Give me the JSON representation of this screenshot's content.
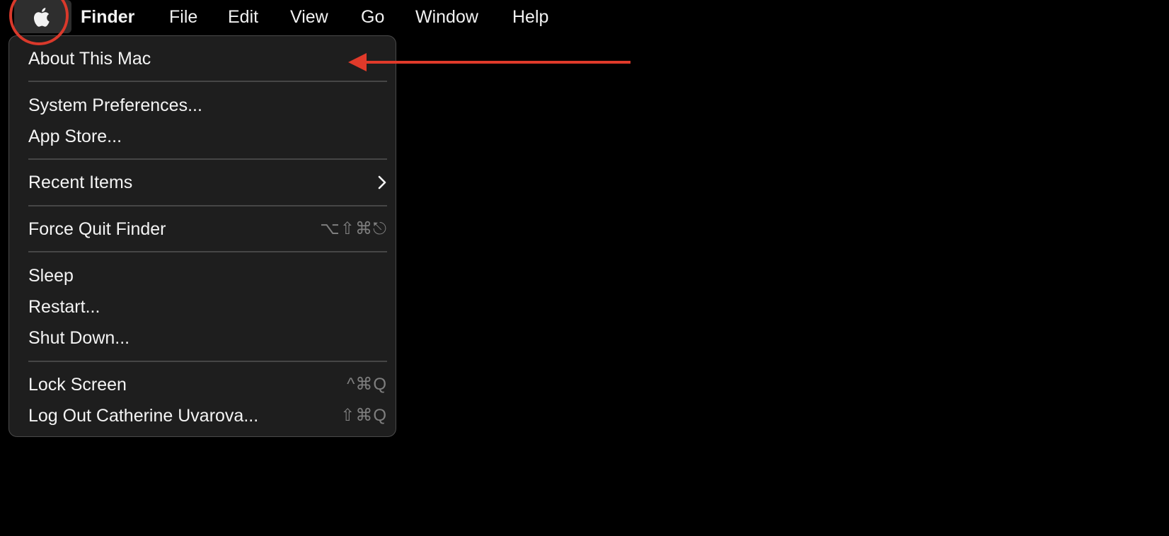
{
  "menubar": {
    "app_name": "Finder",
    "items": [
      "File",
      "Edit",
      "View",
      "Go",
      "Window",
      "Help"
    ],
    "apple_icon": "apple-logo-icon"
  },
  "apple_menu": {
    "about": "About This Mac",
    "system_preferences": "System Preferences...",
    "app_store": "App Store...",
    "recent_items": "Recent Items",
    "force_quit": "Force Quit Finder",
    "force_quit_shortcut": "⌥⇧⌘⎋",
    "sleep": "Sleep",
    "restart": "Restart...",
    "shut_down": "Shut Down...",
    "lock_screen": "Lock Screen",
    "lock_screen_shortcut": "^⌘Q",
    "log_out": "Log Out Catherine Uvarova...",
    "log_out_shortcut": "⇧⌘Q"
  },
  "annotations": {
    "highlight_color": "#d9392b",
    "arrow_color": "#e03a2a"
  },
  "colors": {
    "background": "#000000",
    "menu_background": "#1e1e1e",
    "menu_text": "#f4f4f4",
    "shortcut_text": "#7e7e7e"
  }
}
